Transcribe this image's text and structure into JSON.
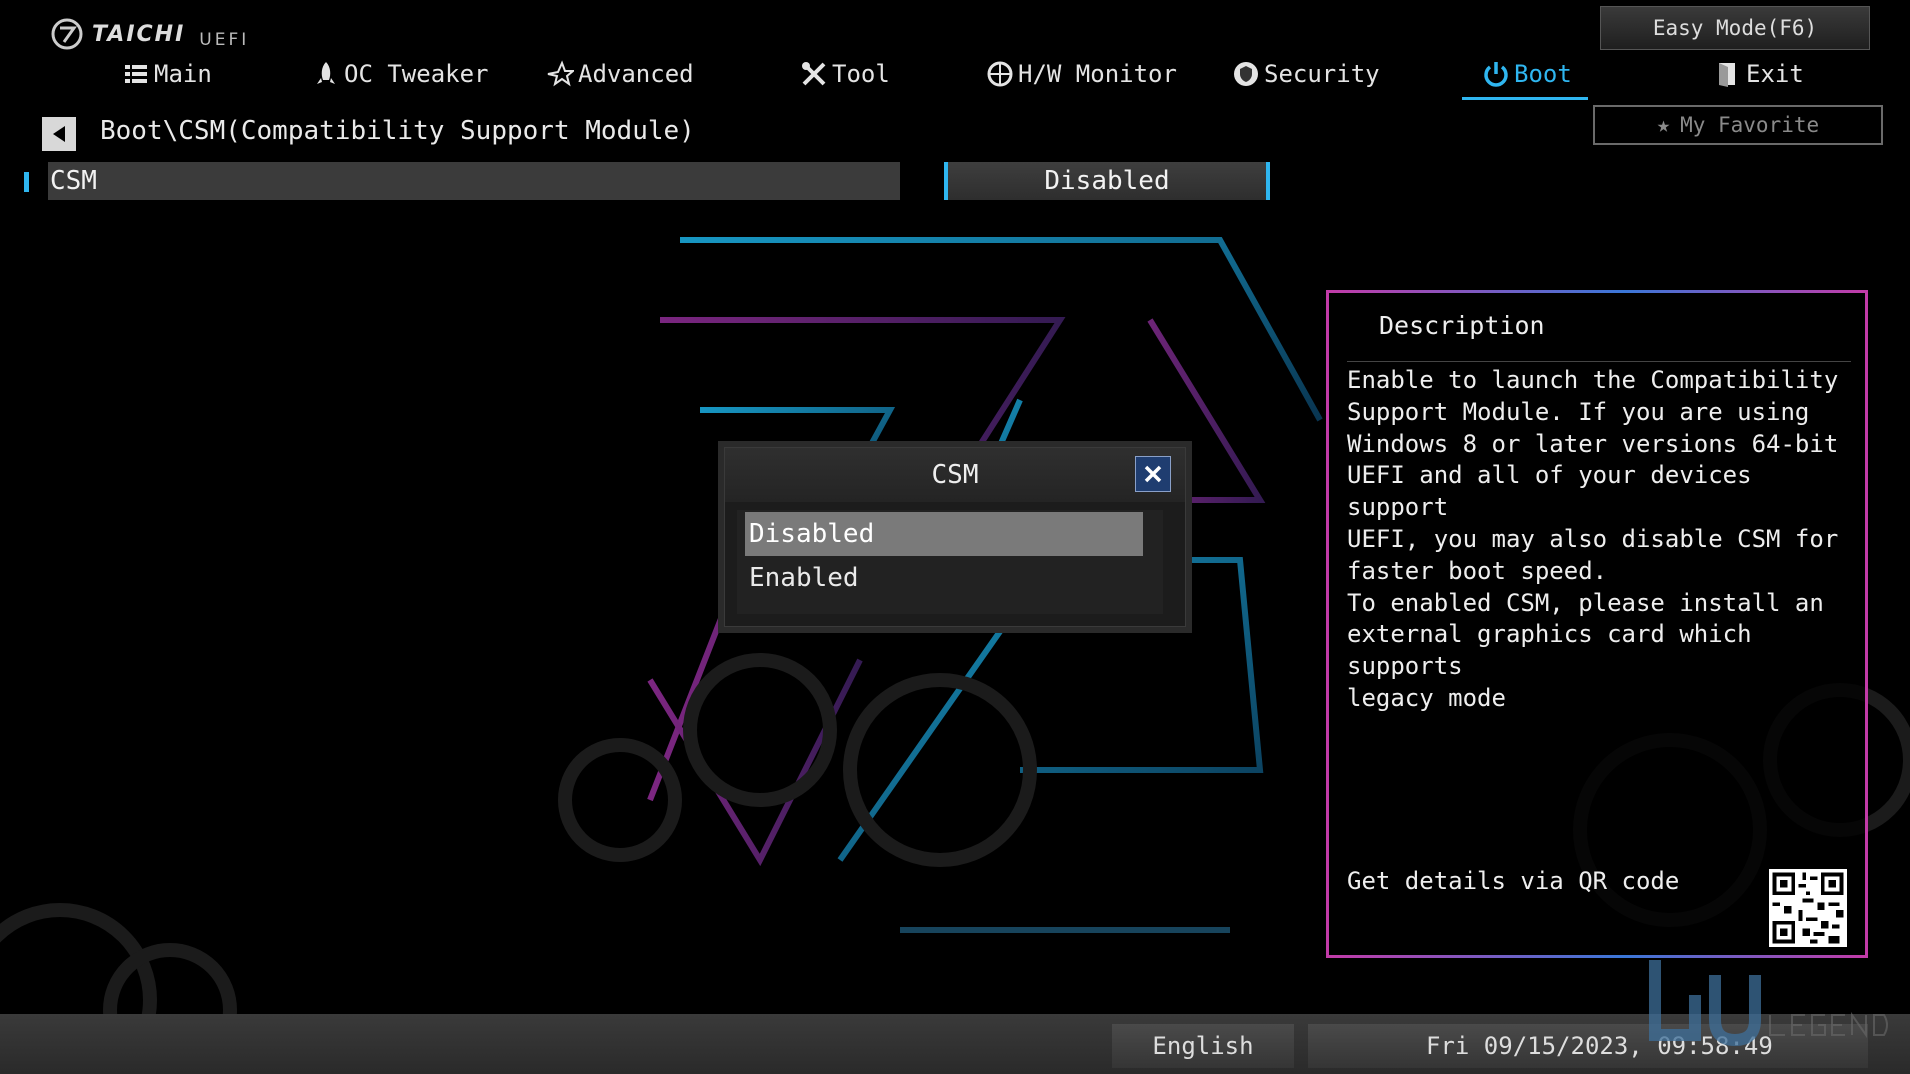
{
  "brand": {
    "logo_text": "TAICHI",
    "logo_sub": "UEFI"
  },
  "header": {
    "easy_mode_label": "Easy Mode(F6)",
    "favorite_label": "My Favorite"
  },
  "tabs": [
    {
      "label": "Main",
      "icon": "list-icon"
    },
    {
      "label": "OC Tweaker",
      "icon": "rocket-icon"
    },
    {
      "label": "Advanced",
      "icon": "star-icon"
    },
    {
      "label": "Tool",
      "icon": "wrench-icon"
    },
    {
      "label": "H/W Monitor",
      "icon": "monitor-icon"
    },
    {
      "label": "Security",
      "icon": "shield-icon"
    },
    {
      "label": "Boot",
      "icon": "power-icon",
      "active": true
    },
    {
      "label": "Exit",
      "icon": "exit-icon"
    }
  ],
  "breadcrumb": "Boot\\CSM(Compatibility Support Module)",
  "setting": {
    "label": "CSM",
    "value": "Disabled"
  },
  "popup": {
    "title": "CSM",
    "options": [
      {
        "label": "Disabled",
        "selected": true
      },
      {
        "label": "Enabled",
        "selected": false
      }
    ]
  },
  "description": {
    "title": "Description",
    "text": "Enable to launch the Compatibility\nSupport Module. If you are using\nWindows 8 or later versions 64-bit\nUEFI and all of your devices support\nUEFI, you may also disable CSM for\nfaster boot speed.\nTo enabled CSM, please install an\nexternal graphics card which supports\nlegacy mode",
    "qr_label": "Get details via QR code"
  },
  "footer": {
    "language": "English",
    "datetime": "Fri 09/15/2023, 09:58:49"
  },
  "colors": {
    "accent": "#2fb6f0",
    "panel_border": "#c23ba8"
  }
}
